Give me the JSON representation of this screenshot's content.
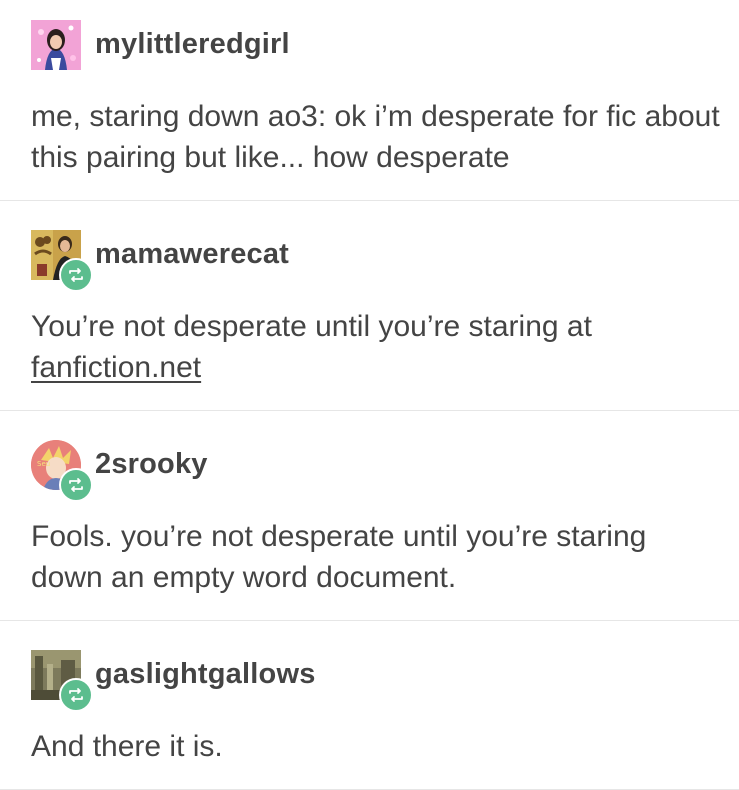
{
  "posts": [
    {
      "username": "mylittleredgirl",
      "text": "me, staring down ao3: ok i’m desperate for fic about this pairing but like... how desperate",
      "reblog": false
    },
    {
      "username": "mamawerecat",
      "text_before_link": "You’re not desperate until you’re staring at ",
      "link_text": "fanfiction.net",
      "reblog": true
    },
    {
      "username": "2srooky",
      "text": "Fools. you’re not desperate until you’re staring down an empty word document.",
      "reblog": true
    },
    {
      "username": "gaslightgallows",
      "text": "And there it is.",
      "reblog": true
    }
  ],
  "colors": {
    "text": "#444444",
    "reblog_badge": "#5cbd8e",
    "divider": "#e6e6e6"
  },
  "icons": {
    "reblog": "reblog-icon"
  }
}
